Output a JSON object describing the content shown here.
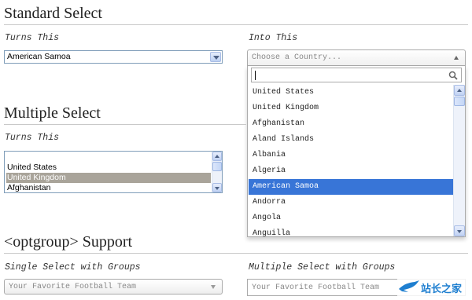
{
  "sections": {
    "standard": {
      "title": "Standard Select",
      "turns_label": "Turns This",
      "into_label": "Into This",
      "native_value": "American Samoa",
      "chosen_placeholder": "Choose a Country...",
      "search_value": "",
      "options": [
        "United States",
        "United Kingdom",
        "Afghanistan",
        "Aland Islands",
        "Albania",
        "Algeria",
        "American Samoa",
        "Andorra",
        "Angola",
        "Anguilla"
      ],
      "highlighted_option": "American Samoa"
    },
    "multiple": {
      "title": "Multiple Select",
      "turns_label": "Turns This",
      "list_items": [
        "United States",
        "United Kingdom",
        "Afghanistan"
      ],
      "selected_item": "United Kingdom"
    },
    "optgroup": {
      "title": "<optgroup> Support",
      "single_label": "Single Select with Groups",
      "multiple_label": "Multiple Select with Groups",
      "single_placeholder": "Your Favorite Football Team",
      "multiple_placeholder": "Your Favorite Football Team"
    }
  },
  "watermark": {
    "text": "站长之家",
    "icon": "bird-logo"
  },
  "colors": {
    "highlight": "#3875d7",
    "list_selected": "#a9a49a",
    "rule": "#c9c9c9",
    "watermark": "#1f7fd0"
  }
}
